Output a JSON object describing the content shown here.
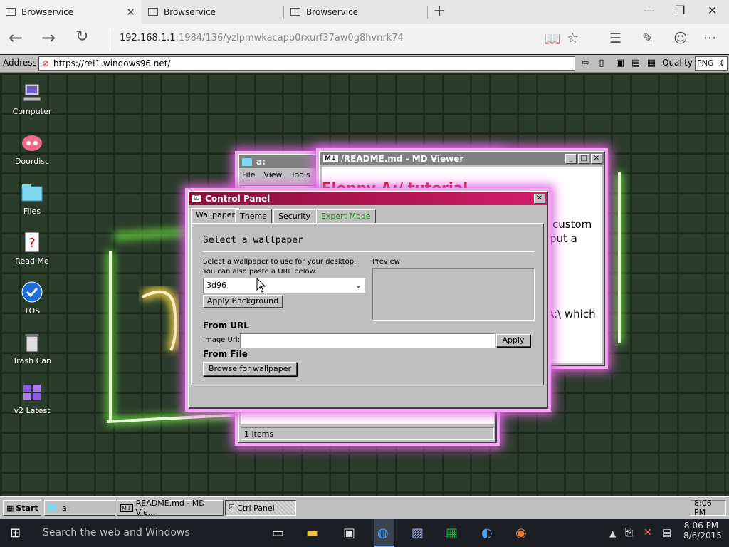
{
  "browser": {
    "tabs": [
      {
        "label": "Browservice",
        "active": true
      },
      {
        "label": "Browservice",
        "active": false
      },
      {
        "label": "Browservice",
        "active": false
      }
    ],
    "url_host": "192.168.1.1",
    "url_rest": ":1984/136/yzlpmwkacapp0rxurf37aw0g8hvnrk74"
  },
  "addressbar": {
    "label": "Address",
    "value": "https://rel1.windows96.net/",
    "quality_label": "Quality",
    "quality_value": "PNG"
  },
  "desktop_icons": [
    {
      "label": "Computer",
      "icon": "computer-icon"
    },
    {
      "label": "Doordisc",
      "icon": "discord-icon"
    },
    {
      "label": "Files",
      "icon": "folder-icon"
    },
    {
      "label": "Read Me",
      "icon": "help-icon"
    },
    {
      "label": "TOS",
      "icon": "check-icon"
    },
    {
      "label": "Trash Can",
      "icon": "trash-icon"
    },
    {
      "label": "v2 Latest",
      "icon": "windows-icon"
    }
  ],
  "explorer": {
    "title": "a:",
    "menu": [
      "File",
      "View",
      "Tools"
    ],
    "status": "1 items"
  },
  "mdviewer": {
    "title": "/README.md - MD Viewer",
    "heading": "Floppy A:/ tutorial",
    "text1": "custom",
    "text2": "put a",
    "text3": "A:\\ which"
  },
  "control_panel": {
    "title": "Control Panel",
    "tabs": [
      "Wallpaper",
      "Theme",
      "Security",
      "Expert Mode"
    ],
    "heading": "Select a wallpaper",
    "desc1": "Select a wallpaper to use for your desktop.",
    "desc2": "You can also paste a URL below.",
    "select_value": "3d96",
    "apply_bg": "Apply Background",
    "preview_label": "Preview",
    "from_url": "From URL",
    "image_url_label": "Image Url:",
    "apply": "Apply",
    "from_file": "From File",
    "browse": "Browse for wallpaper"
  },
  "taskbar": {
    "start": "Start",
    "items": [
      "a:",
      "README.md - MD Vie...",
      "Ctrl Panel"
    ],
    "clock": "8:06 PM"
  },
  "windows_taskbar": {
    "search": "Search the web and Windows",
    "time": "8:06 PM",
    "date": "8/6/2015"
  },
  "colors": {
    "accent_glow": "#e060e0",
    "title_active": "#c0145a",
    "title_inactive": "#808080"
  }
}
